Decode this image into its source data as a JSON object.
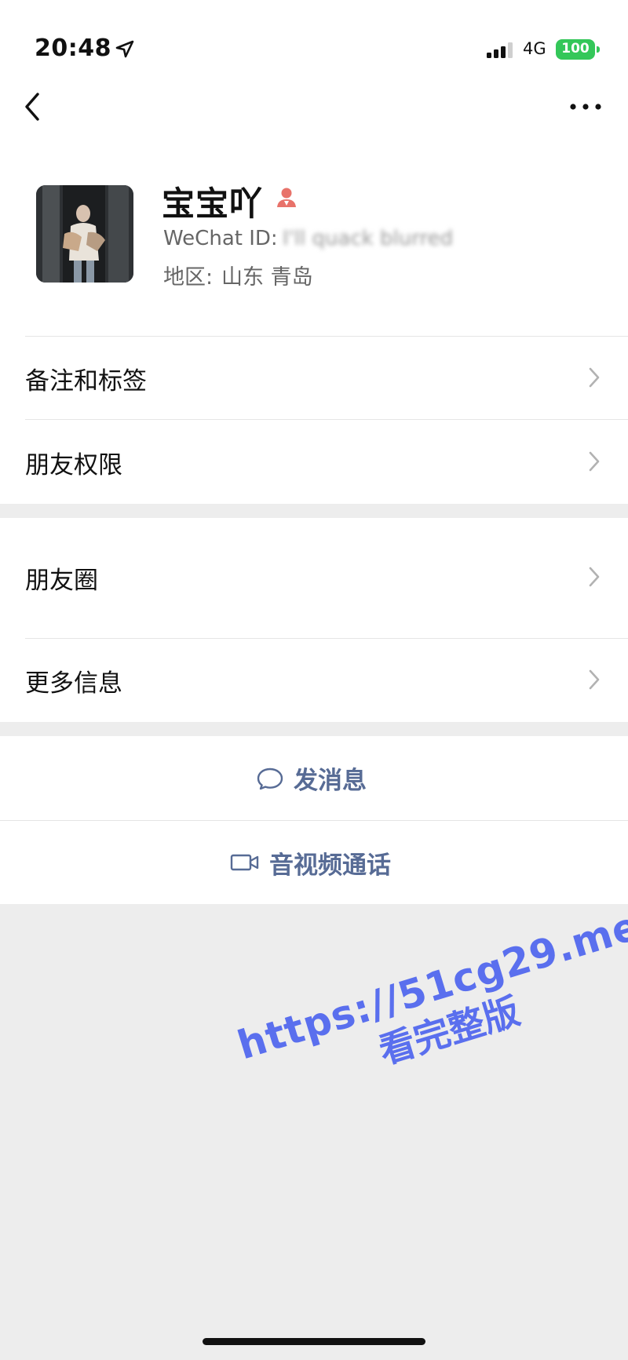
{
  "status_bar": {
    "time": "20:48",
    "network": "4G",
    "battery": "100"
  },
  "nav": {
    "back_icon": "chevron-left-icon",
    "more_icon": "ellipsis-icon"
  },
  "profile": {
    "name": "宝宝吖",
    "wechat_id_label": "WeChat ID: ",
    "wechat_id_value": "I'll quack blurred",
    "region_label": "地区:",
    "region_value": "山东 青岛",
    "gender_icon": "female-icon"
  },
  "menu": {
    "remark_tags": "备注和标签",
    "friend_permissions": "朋友权限",
    "moments": "朋友圈",
    "more_info": "更多信息"
  },
  "actions": {
    "send_message": "发消息",
    "video_call": "音视频通话"
  },
  "watermark": {
    "url": "https://51cg29.me",
    "text": "看完整版"
  },
  "colors": {
    "link": "#576b95",
    "battery": "#34c759",
    "gender": "#e8726a",
    "watermark": "#5a6fee",
    "background": "#ededed"
  }
}
